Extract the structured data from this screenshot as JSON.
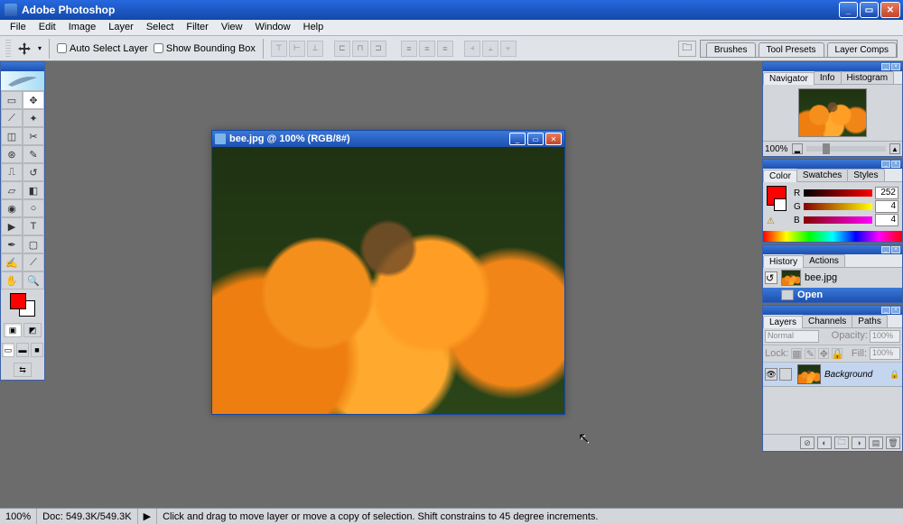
{
  "app": {
    "title": "Adobe Photoshop"
  },
  "menu": [
    "File",
    "Edit",
    "Image",
    "Layer",
    "Select",
    "Filter",
    "View",
    "Window",
    "Help"
  ],
  "options": {
    "auto_select_label": "Auto Select Layer",
    "bounding_box_label": "Show Bounding Box"
  },
  "dock_tabs": [
    "Brushes",
    "Tool Presets",
    "Layer Comps"
  ],
  "document": {
    "title": "bee.jpg @ 100% (RGB/8#)"
  },
  "navigator": {
    "tabs": [
      "Navigator",
      "Info",
      "Histogram"
    ],
    "zoom": "100%"
  },
  "color": {
    "tabs": [
      "Color",
      "Swatches",
      "Styles"
    ],
    "channels": [
      {
        "label": "R",
        "value": "252"
      },
      {
        "label": "G",
        "value": "4"
      },
      {
        "label": "B",
        "value": "4"
      }
    ]
  },
  "history": {
    "tabs": [
      "History",
      "Actions"
    ],
    "doc_name": "bee.jpg",
    "state": "Open"
  },
  "layers": {
    "tabs": [
      "Layers",
      "Channels",
      "Paths"
    ],
    "mode": "Normal",
    "opacity_label": "Opacity:",
    "opacity_value": "100%",
    "lock_label": "Lock:",
    "fill_label": "Fill:",
    "fill_value": "100%",
    "layer_name": "Background"
  },
  "status": {
    "zoom": "100%",
    "doc_info": "Doc: 549.3K/549.3K",
    "hint": "Click and drag to move layer or move a copy of selection. Shift constrains to 45 degree increments."
  }
}
